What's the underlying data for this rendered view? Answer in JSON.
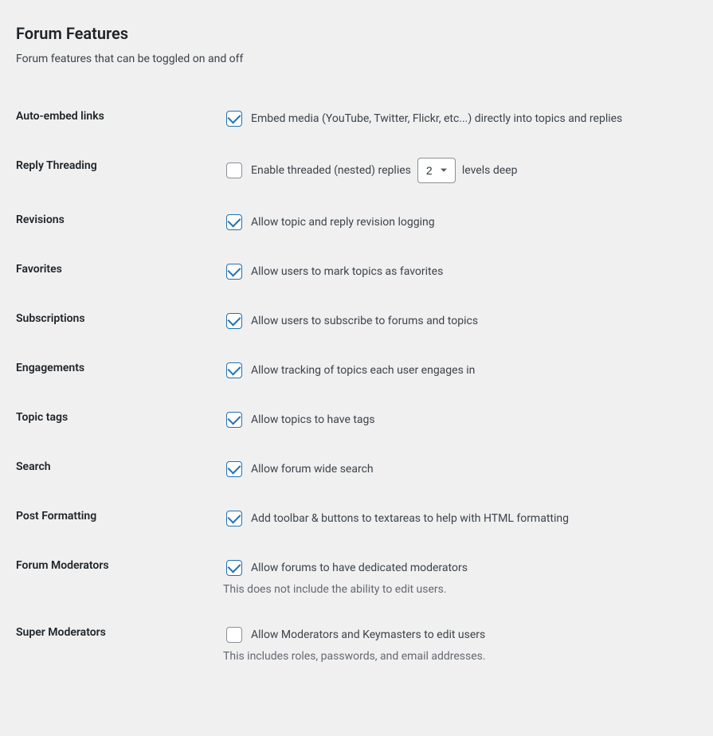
{
  "section": {
    "title": "Forum Features",
    "description": "Forum features that can be toggled on and off"
  },
  "rows": {
    "auto_embed": {
      "label": "Auto-embed links",
      "checkbox_label": "Embed media (YouTube, Twitter, Flickr, etc...) directly into topics and replies",
      "checked": true
    },
    "reply_threading": {
      "label": "Reply Threading",
      "label_before": "Enable threaded (nested) replies",
      "label_after": "levels deep",
      "checked": false,
      "select_value": "2"
    },
    "revisions": {
      "label": "Revisions",
      "checkbox_label": "Allow topic and reply revision logging",
      "checked": true
    },
    "favorites": {
      "label": "Favorites",
      "checkbox_label": "Allow users to mark topics as favorites",
      "checked": true
    },
    "subscriptions": {
      "label": "Subscriptions",
      "checkbox_label": "Allow users to subscribe to forums and topics",
      "checked": true
    },
    "engagements": {
      "label": "Engagements",
      "checkbox_label": "Allow tracking of topics each user engages in",
      "checked": true
    },
    "topic_tags": {
      "label": "Topic tags",
      "checkbox_label": "Allow topics to have tags",
      "checked": true
    },
    "search": {
      "label": "Search",
      "checkbox_label": "Allow forum wide search",
      "checked": true
    },
    "post_formatting": {
      "label": "Post Formatting",
      "checkbox_label": "Add toolbar & buttons to textareas to help with HTML formatting",
      "checked": true
    },
    "forum_moderators": {
      "label": "Forum Moderators",
      "checkbox_label": "Allow forums to have dedicated moderators",
      "description": "This does not include the ability to edit users.",
      "checked": true
    },
    "super_moderators": {
      "label": "Super Moderators",
      "checkbox_label": "Allow Moderators and Keymasters to edit users",
      "description": "This includes roles, passwords, and email addresses.",
      "checked": false
    }
  }
}
